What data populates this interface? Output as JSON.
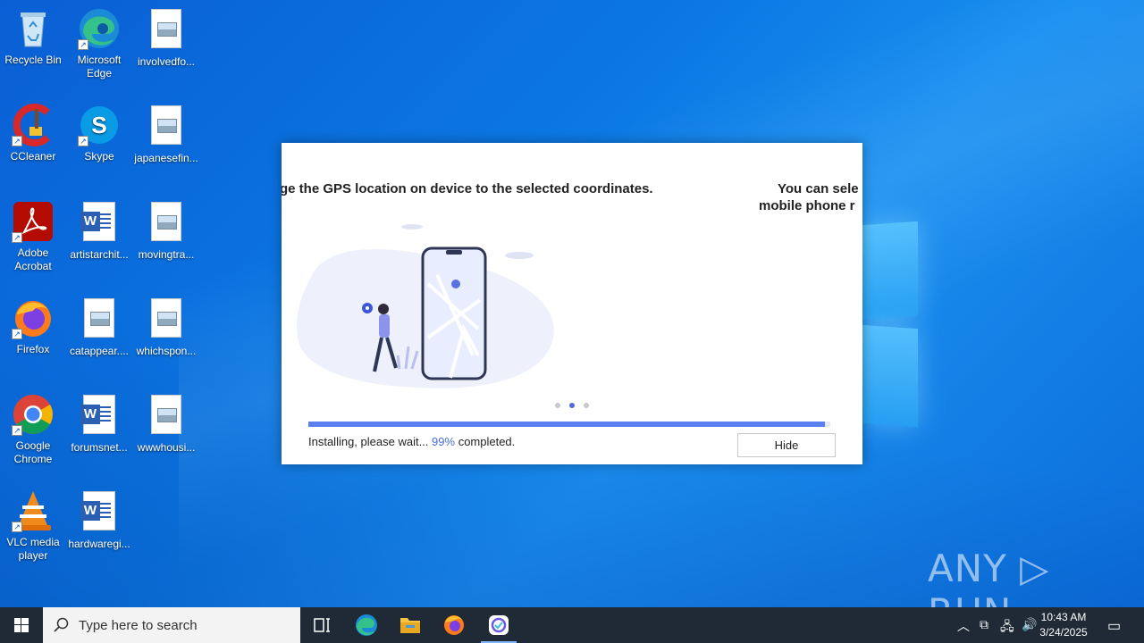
{
  "desktop_icons": [
    {
      "name": "recycle-bin",
      "label": "Recycle Bin"
    },
    {
      "name": "edge",
      "label": "Microsoft Edge"
    },
    {
      "name": "file1",
      "label": "involvedfo..."
    },
    {
      "name": "ccleaner",
      "label": "CCleaner"
    },
    {
      "name": "skype",
      "label": "Skype"
    },
    {
      "name": "file2",
      "label": "japanesefin..."
    },
    {
      "name": "acrobat",
      "label": "Adobe Acrobat"
    },
    {
      "name": "doc1",
      "label": "artistarchit..."
    },
    {
      "name": "file3",
      "label": "movingtra..."
    },
    {
      "name": "firefox",
      "label": "Firefox"
    },
    {
      "name": "file4",
      "label": "catappear...."
    },
    {
      "name": "file5",
      "label": "whichspon..."
    },
    {
      "name": "chrome",
      "label": "Google Chrome"
    },
    {
      "name": "doc2",
      "label": "forumsnet..."
    },
    {
      "name": "file6",
      "label": "wwwhousi..."
    },
    {
      "name": "vlc",
      "label": "VLC media player"
    },
    {
      "name": "doc3",
      "label": "hardwaregi..."
    }
  ],
  "dialog": {
    "slide_text_left": "ge the GPS location on device to the selected coordinates.",
    "slide_text_right_1": "You can sele",
    "slide_text_right_2": "mobile phone r",
    "status_prefix": "Installing, please wait...",
    "progress_percent": "99%",
    "status_suffix": "completed.",
    "progress_fraction": 0.99,
    "hide_label": "Hide"
  },
  "watermark": "ANY ▷ RUN",
  "taskbar": {
    "search_placeholder": "Type here to search",
    "time": "10:43 AM",
    "date": "3/24/2025"
  },
  "colors": {
    "accent": "#4a6ee0",
    "progress": "#5a7ff0",
    "taskbar": "#1f2a36"
  }
}
